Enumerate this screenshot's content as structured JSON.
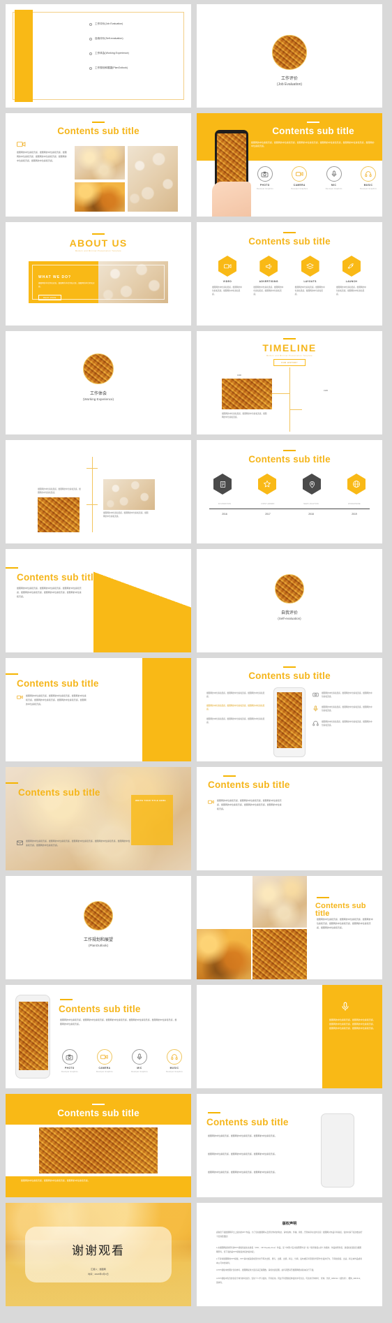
{
  "theme": {
    "accent": "#f9b916",
    "accent_dark": "#e8a400",
    "text_dark": "#3b3b3b",
    "bg": "#d9d9d9"
  },
  "common": {
    "sub_title": "Contents sub title",
    "body_placeholder": "摄图网的中位素和灵感，摄图网的中位素和灵感，摄图网的中位素和灵感，摄图网的中位素和灵感，摄图网的中位素和灵感，摄图网的中位素和灵感。",
    "body_short": "摄图网的中位素和灵感，摄图网的中位素和灵感，摄图网的中位素和灵感。",
    "template_tagline": "Modern and Minimal Presentation Template",
    "descipet": "Descipet Graphics"
  },
  "slides": {
    "cover": {
      "name": "cover-slide",
      "menu": [
        {
          "label": "工作评价(Job Evaluation)"
        },
        {
          "label": "自我评价(Self-evaluation)"
        },
        {
          "label": "工作体会(Working Experience)"
        },
        {
          "label": "工作规划和展望(PlanOutlook)"
        }
      ]
    },
    "section_job": {
      "cn": "工作评价",
      "en": "(Job Evaluation)"
    },
    "section_work": {
      "cn": "工作体会",
      "en": "(Working Experience)"
    },
    "section_self": {
      "cn": "自我评价",
      "en": "(Self-evaluation)"
    },
    "section_plan": {
      "cn": "工作规划和展望",
      "en": "(PlanOutlook)"
    },
    "about": {
      "title": "ABOUT US",
      "panel_title": "WHAT WE DO?",
      "button": "READ MORE"
    },
    "phone_icons": [
      {
        "label": "PHOTO",
        "sub": "Descipet Graphics",
        "icon": "camera-icon"
      },
      {
        "label": "CAMERA",
        "sub": "Descipet Graphics",
        "icon": "video-icon"
      },
      {
        "label": "MIC",
        "sub": "Descipet Graphics",
        "icon": "mic-icon"
      },
      {
        "label": "MUSIC",
        "sub": "Descipet Graphics",
        "icon": "headphones-icon"
      }
    ],
    "hex_items": [
      {
        "label": "VIDEO",
        "icon": "video-icon"
      },
      {
        "label": "ADVERTISING",
        "icon": "megaphone-icon"
      },
      {
        "label": "LAYOUTS",
        "icon": "layers-icon"
      },
      {
        "label": "LAUNCH",
        "icon": "rocket-icon"
      }
    ],
    "timeline": {
      "title": "TIMELINE",
      "badge": "OUR HISTORY",
      "entries": [
        {
          "year": "1990"
        },
        {
          "year": "1995"
        }
      ]
    },
    "year_row": {
      "years": [
        "2016",
        "2017",
        "2018",
        "2019"
      ],
      "icons": [
        {
          "icon": "document-icon",
          "label": "FOUNDATION"
        },
        {
          "icon": "star-icon",
          "label": "FIRST AWARD"
        },
        {
          "icon": "pin-icon",
          "label": "NEW LOCATION"
        },
        {
          "icon": "globe-icon",
          "label": "WORLDWIDE"
        }
      ]
    },
    "side_band": {
      "text": "WRITE YOUR TITLE HERE"
    },
    "thanks": {
      "title": "谢谢观看",
      "line1": "汇报人：摄图网",
      "line2": "时间：2018年X月X日"
    },
    "copyright": {
      "title": "版权声明",
      "intro": "感谢您下载摄图网平台上提供的PPT作品，为了您和摄图网以及原创作者的利益，请勿复制、传播、销售，否则将承担法律责任！摄图网对作品享有版权，使用时请下载次数进行十倍的赔偿损！",
      "items": [
        "1.在摄图网提供所有的PPT模板准会免免版权（VRF：VIP Royalty-Free）作品，受《中国人民共和国著作法》和《世界版权公约》的保护，作品的所有权、版权和处置权归摄图网所有，您下载的是PPT模板使用权的使用权；",
        "2.不得将摄图网的PPT模板、PPT素材或其组成部分用于再次出售、赠与、出租、出借、转让、分销、发布或任何可能替代原作分发的行为，不得擅授权、出卖、转让本作品或者本公司中的资料；",
        "3.PPT模板中的图片仅供参考，摄图网提供大量高清正版图数，请按用途链图，如有需要请至摄图网相关版块自行下载；",
        "4.PPT模板中包含的创意字体为参考展示，仅供个人学习使用，不得商用，同业不得因授权体使用许可负责，可商用字体参考：宋体、仿宋_GB2312（或仿宋）、楷体_GB2312、黑体等。"
      ]
    }
  }
}
